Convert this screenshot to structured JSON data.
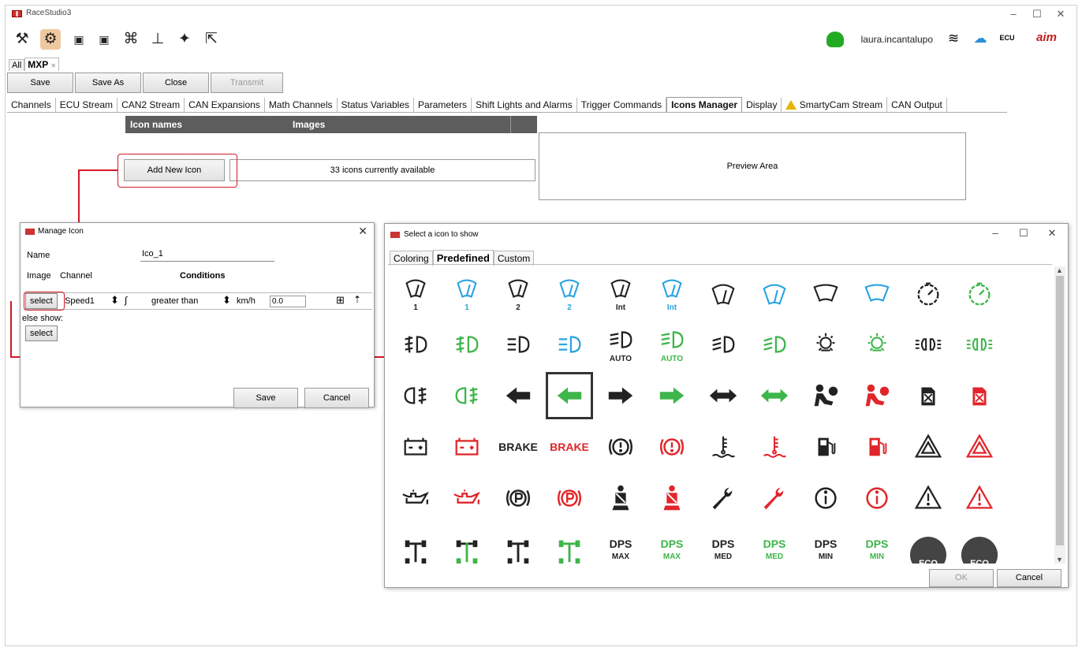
{
  "app": {
    "title": "RaceStudio3",
    "user": "laura.incantalupo",
    "ecu_label": "ECU"
  },
  "doc_tabs": {
    "all": "All",
    "active": "MXP",
    "close": "✕"
  },
  "actions": {
    "save": "Save",
    "save_as": "Save As",
    "close": "Close",
    "transmit": "Transmit"
  },
  "main_tabs": [
    "Channels",
    "ECU Stream",
    "CAN2 Stream",
    "CAN Expansions",
    "Math Channels",
    "Status Variables",
    "Parameters",
    "Shift Lights and Alarms",
    "Trigger Commands",
    "Icons Manager",
    "Display",
    "SmartyCam Stream",
    "CAN Output"
  ],
  "icons_manager": {
    "col_names": "Icon names",
    "col_images": "Images",
    "add_button": "Add New Icon",
    "available": "33 icons currently available",
    "preview": "Preview Area"
  },
  "manage_icon": {
    "title": "Manage Icon",
    "name_label": "Name",
    "name_value": "Ico_1",
    "image_label": "Image",
    "channel_label": "Channel",
    "conditions_label": "Conditions",
    "select_button": "select",
    "channel_value": "Speed1",
    "condition": "greater than",
    "unit": "km/h",
    "threshold": "0.0",
    "else_label": "else show:",
    "else_select": "select",
    "save": "Save",
    "cancel": "Cancel"
  },
  "select_icon": {
    "title": "Select a icon to show",
    "tabs": [
      "Coloring",
      "Predefined",
      "Custom"
    ],
    "ok": "OK",
    "cancel": "Cancel",
    "texts": {
      "n1": "1",
      "n2": "2",
      "int": "Int",
      "auto": "AUTO",
      "brake": "BRAKE",
      "dps": "DPS",
      "max": "MAX",
      "med": "MED",
      "min": "MIN",
      "eco": "ECO"
    }
  },
  "colors": {
    "black": "#222222",
    "blue": "#2aa3e0",
    "green": "#3db54a",
    "red": "#e0262b",
    "highlight": "#d4192a"
  }
}
